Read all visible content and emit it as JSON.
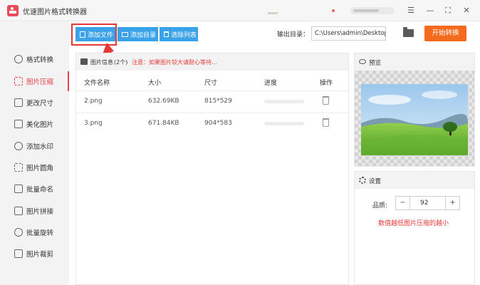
{
  "window": {
    "title": "优速图片格式转换器",
    "controls": {
      "menu": "☰",
      "minimize": "—",
      "maximize": "⛶",
      "close": "✕"
    }
  },
  "sidebar": {
    "items": [
      {
        "label": "格式转换",
        "icon": "format-convert-icon",
        "active": false
      },
      {
        "label": "图片压缩",
        "icon": "compress-icon",
        "active": true
      },
      {
        "label": "更改尺寸",
        "icon": "resize-icon",
        "active": false
      },
      {
        "label": "美化图片",
        "icon": "beautify-icon",
        "active": false
      },
      {
        "label": "添加水印",
        "icon": "watermark-icon",
        "active": false
      },
      {
        "label": "图片圆角",
        "icon": "round-corner-icon",
        "active": false
      },
      {
        "label": "批量命名",
        "icon": "rename-icon",
        "active": false
      },
      {
        "label": "图片拼接",
        "icon": "stitch-icon",
        "active": false
      },
      {
        "label": "批量旋转",
        "icon": "rotate-icon",
        "active": false
      },
      {
        "label": "图片裁剪",
        "icon": "crop-icon",
        "active": false
      }
    ]
  },
  "toolbar": {
    "add_file": "添加文件",
    "add_folder": "添加目录",
    "clear_list": "清除列表",
    "output_label": "输出目录：",
    "output_path": "C:\\Users\\admin\\Desktop",
    "start": "开始转换"
  },
  "file_list": {
    "title": "图片信息",
    "count": "(2个)",
    "note": "注意：如果图片较大请耐心等待...",
    "columns": [
      "文件名称",
      "大小",
      "尺寸",
      "进度",
      "操作"
    ],
    "rows": [
      {
        "name": "2.png",
        "size": "632.69KB",
        "dimensions": "815*529",
        "progress": 0
      },
      {
        "name": "3.png",
        "size": "671.84KB",
        "dimensions": "904*583",
        "progress": 0
      }
    ]
  },
  "preview": {
    "title": "预览"
  },
  "settings": {
    "title": "设置",
    "quality_label": "品质:",
    "quality_value": "92",
    "minus": "−",
    "plus": "+",
    "hint": "数值越低图片压缩的越小"
  },
  "colors": {
    "accent_red": "#e9424f",
    "button_blue": "#3aa2e8",
    "start_orange": "#f46b1e",
    "annotation_red": "#e53935"
  }
}
